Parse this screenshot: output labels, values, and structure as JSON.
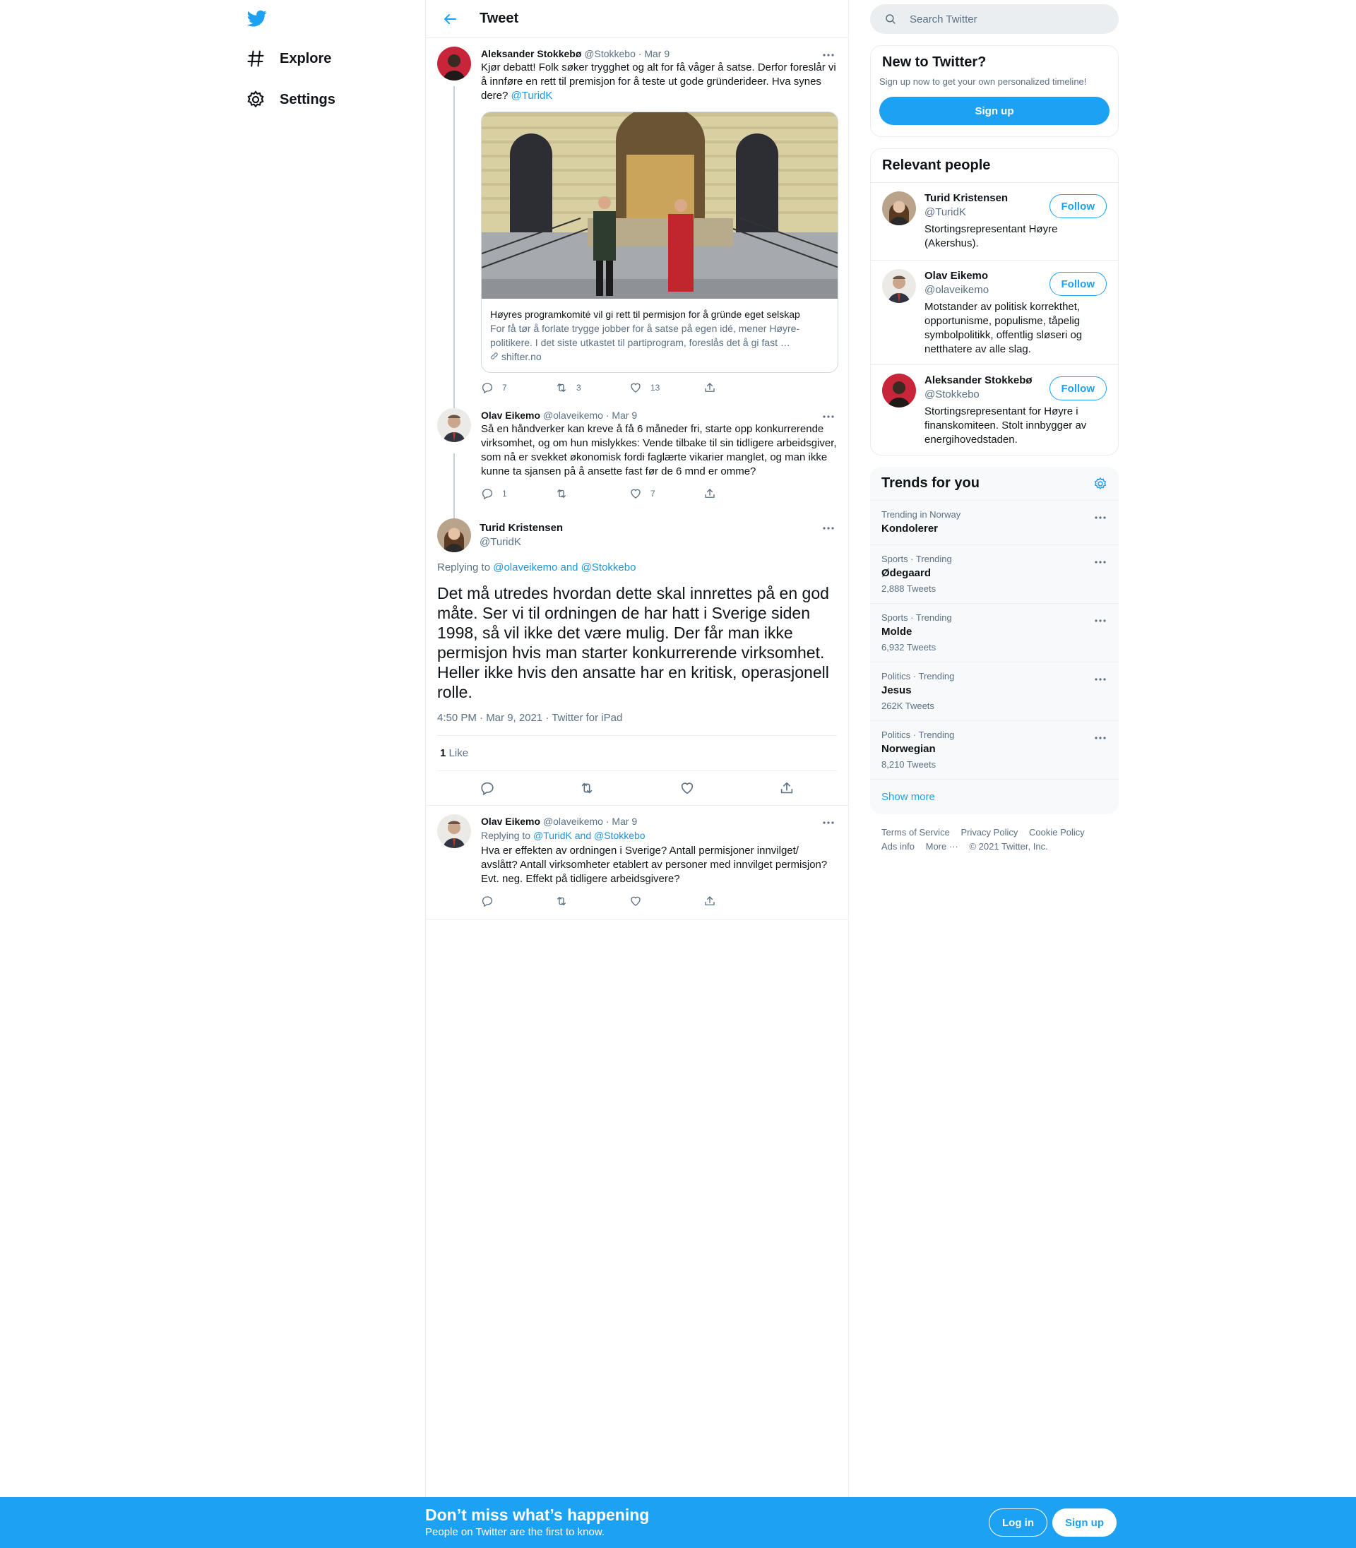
{
  "nav": {
    "explore_label": "Explore",
    "settings_label": "Settings"
  },
  "header": {
    "title": "Tweet"
  },
  "tweets": [
    {
      "name": "Aleksander Stokkebø",
      "handle": "@Stokkebo",
      "date": "· Mar 9",
      "text": "Kjør debatt! Folk søker trygghet og alt for få våger å satse. Derfor foreslår vi å innføre en rett til premisjon for å teste ut gode gründerideer. Hva synes dere?",
      "mention": "@TuridK",
      "card": {
        "title": "Høyres programkomité vil gi rett til permisjon for å gründe eget selskap",
        "desc": "For få tør å forlate trygge jobber for å satse på egen idé, mener Høyre-politikere. I det siste utkastet til partiprogram, foreslås det å gi fast …",
        "url": "shifter.no"
      },
      "replies": "7",
      "retweets": "3",
      "likes": "13"
    },
    {
      "name": "Olav Eikemo",
      "handle": "@olaveikemo",
      "date": "· Mar 9",
      "text": "Så en håndverker kan kreve å få 6 måneder fri, starte opp konkurrerende virksomhet, og om hun mislykkes: Vende tilbake til sin tidligere arbeidsgiver, som nå er svekket økonomisk fordi faglærte vikarier manglet, og man ikke kunne ta sjansen på å ansette fast før de 6 mnd er omme?",
      "replies": "1",
      "retweets": "",
      "likes": "7"
    }
  ],
  "focus": {
    "name": "Turid Kristensen",
    "handle": "@TuridK",
    "replying_prefix": "Replying to",
    "replying_users": "@olaveikemo and @Stokkebo",
    "text": "Det må utredes hvordan dette skal innrettes på en god måte. Ser vi til ordningen de har hatt i Sverige siden 1998, så vil ikke det være mulig. Der får man ikke permisjon hvis man starter konkurrerende virksomhet. Heller ikke hvis den ansatte har en kritisk, operasjonell rolle.",
    "timestamp": "4:50 PM · Mar 9, 2021 · Twitter for iPad",
    "like_count": "1",
    "like_label": "Like"
  },
  "reply": {
    "name": "Olav Eikemo",
    "handle": "@olaveikemo",
    "date": "· Mar 9",
    "replying_prefix": "Replying to",
    "replying_users": "@TuridK and @Stokkebo",
    "text": "Hva er effekten av ordningen i Sverige? Antall permisjoner innvilget/ avslått? Antall virksomheter etablert av personer med innvilget permisjon? Evt. neg. Effekt på tidligere arbeidsgivere?"
  },
  "search": {
    "placeholder": "Search Twitter"
  },
  "new_to_twitter": {
    "title": "New to Twitter?",
    "subtitle": "Sign up now to get your own personalized timeline!",
    "button": "Sign up"
  },
  "relevant": {
    "title": "Relevant people",
    "people": [
      {
        "name": "Turid Kristensen",
        "handle": "@TuridK",
        "bio": "Stortingsrepresentant Høyre (Akershus).",
        "button": "Follow"
      },
      {
        "name": "Olav Eikemo",
        "handle": "@olaveikemo",
        "bio": "Motstander av politisk korrekthet, opportunisme, populisme, tåpelig symbolpolitikk, offentlig sløseri og netthatere av alle slag.",
        "button": "Follow"
      },
      {
        "name": "Aleksander Stokkebø",
        "handle": "@Stokkebo",
        "bio": "Stortingsrepresentant for Høyre i finanskomiteen. Stolt innbygger av energihovedstaden.",
        "button": "Follow"
      }
    ]
  },
  "trends": {
    "title": "Trends for you",
    "items": [
      {
        "context": "Trending in Norway",
        "name": "Kondolerer",
        "count": ""
      },
      {
        "context": "Sports · Trending",
        "name": "Ødegaard",
        "count": "2,888 Tweets"
      },
      {
        "context": "Sports · Trending",
        "name": "Molde",
        "count": "6,932 Tweets"
      },
      {
        "context": "Politics · Trending",
        "name": "Jesus",
        "count": "262K Tweets"
      },
      {
        "context": "Politics · Trending",
        "name": "Norwegian",
        "count": "8,210 Tweets"
      }
    ],
    "show_more": "Show more"
  },
  "footer": {
    "terms": "Terms of Service",
    "privacy": "Privacy Policy",
    "cookie": "Cookie Policy",
    "ads": "Ads info",
    "more": "More ···",
    "copyright": "© 2021 Twitter, Inc."
  },
  "bottom_bar": {
    "headline": "Don’t miss what’s happening",
    "sub": "People on Twitter are the first to know.",
    "login": "Log in",
    "signup": "Sign up"
  },
  "colors": {
    "accent": "#1da1f2",
    "link": "#1b95e0"
  }
}
